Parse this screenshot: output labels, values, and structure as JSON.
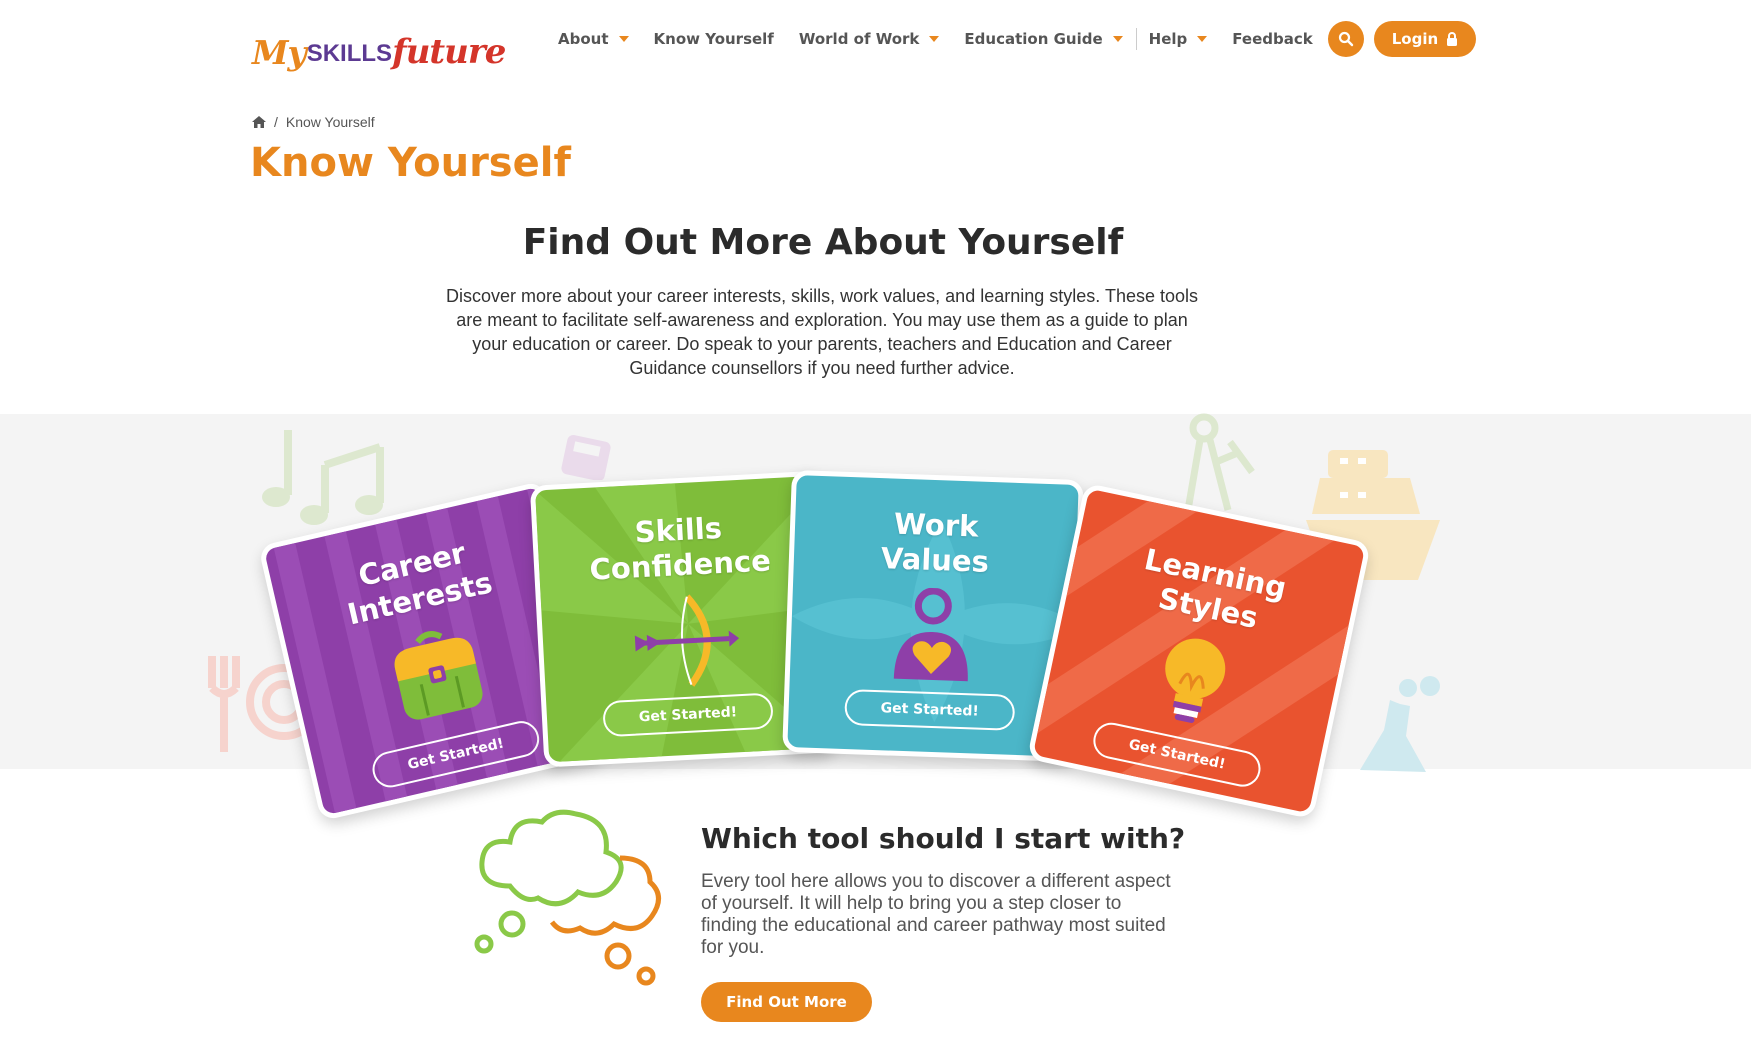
{
  "brand": {
    "logo_my": "My",
    "logo_skills": "SKILLS",
    "logo_future": "future"
  },
  "nav": {
    "items": [
      {
        "label": "About",
        "has_caret": true
      },
      {
        "label": "Know Yourself",
        "has_caret": false
      },
      {
        "label": "World of Work",
        "has_caret": true
      },
      {
        "label": "Education Guide",
        "has_caret": true
      },
      {
        "label": "Help",
        "has_caret": true
      },
      {
        "label": "Feedback",
        "has_caret": false
      }
    ],
    "search_icon": "search-icon",
    "login_label": "Login",
    "login_icon": "lock-icon"
  },
  "breadcrumb": {
    "home_icon": "home-icon",
    "separator": "/",
    "current": "Know Yourself"
  },
  "page_title": "Know Yourself",
  "intro": {
    "title": "Find Out More About Yourself",
    "text": "Discover more about your career interests, skills, work values, and learning styles. These tools are meant to facilitate self-awareness and exploration. You may use them as a guide to plan your education or career. Do speak to your parents, teachers and Education and Career Guidance counsellors if you need further advice."
  },
  "cards": [
    {
      "title_line1": "Career",
      "title_line2": "Interests",
      "button": "Get Started!",
      "color": "#8e3fa8",
      "icon": "briefcase-icon"
    },
    {
      "title_line1": "Skills",
      "title_line2": "Confidence",
      "button": "Get Started!",
      "color": "#7fbd3a",
      "icon": "bow-arrow-icon"
    },
    {
      "title_line1": "Work",
      "title_line2": "Values",
      "button": "Get Started!",
      "color": "#4bb6c8",
      "icon": "person-heart-icon"
    },
    {
      "title_line1": "Learning",
      "title_line2": "Styles",
      "button": "Get Started!",
      "color": "#e9532f",
      "icon": "lightbulb-icon"
    }
  ],
  "which_tool": {
    "title": "Which tool should I start with?",
    "text": "Every tool here allows you to discover a different aspect of yourself. It will help to bring you a step closer to finding the educational and career pathway most suited for you.",
    "button": "Find Out More"
  },
  "colors": {
    "accent": "#e8871e",
    "brand_purple": "#5c3a92",
    "brand_red": "#d4352a"
  }
}
